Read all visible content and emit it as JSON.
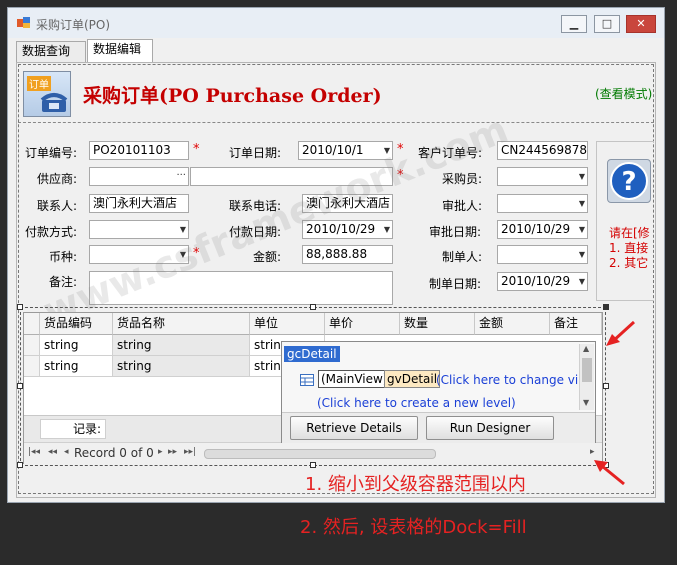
{
  "window": {
    "title": "采购订单(PO)",
    "minimize": "▁",
    "maximize": "□",
    "close": "✕"
  },
  "tabs": [
    {
      "label": "数据查询"
    },
    {
      "label": "数据编辑"
    }
  ],
  "header": {
    "title": "采购订单(PO Purchase Order)",
    "mode": "(查看模式)",
    "logo_text": "订单"
  },
  "form": {
    "order_no_label": "订单编号:",
    "order_no": "PO20101103",
    "order_date_label": "订单日期:",
    "order_date": "2010/10/1",
    "cust_order_label": "客户订单号:",
    "cust_order": "CN244569878",
    "supplier_label": "供应商:",
    "supplier_btn": "···",
    "buyer_label": "采购员:",
    "contact_label": "联系人:",
    "contact": "澳门永利大酒店",
    "phone_label": "联系电话:",
    "phone": "澳门永利大酒店",
    "approver_label": "审批人:",
    "pay_method_label": "付款方式:",
    "pay_date_label": "付款日期:",
    "pay_date": "2010/10/29",
    "approve_date_label": "审批日期:",
    "approve_date": "2010/10/29",
    "currency_label": "币种:",
    "amount_label": "金额:",
    "amount": "88,888.88",
    "creator_label": "制单人:",
    "remark_label": "备注:",
    "create_date_label": "制单日期:",
    "create_date": "2010/10/29",
    "required_mark": "*"
  },
  "side_panel": {
    "help_line1": "请在[修",
    "help_line2": "1. 直接",
    "help_line3": "2. 其它"
  },
  "grid": {
    "columns": [
      "货品编码",
      "货品名称",
      "单位",
      "单价",
      "数量",
      "金额",
      "备注"
    ],
    "rows": [
      [
        "string",
        "string",
        "string"
      ],
      [
        "string",
        "string",
        "string"
      ]
    ],
    "record_label": "记录:",
    "nav_text": "Record 0 of 0",
    "nav_first": "|◂◂",
    "nav_prev_page": "◂◂",
    "nav_prev": "◂",
    "nav_next": "▸",
    "nav_next_page": "▸▸",
    "nav_last": "▸▸|"
  },
  "popup": {
    "root": "gcDetail",
    "main_view": "(MainView)",
    "detail": "gvDetail",
    "change_link": "(Click here to change view",
    "create_link": "(Click here to create a new level)",
    "retrieve_btn": "Retrieve Details",
    "designer_btn": "Run Designer"
  },
  "annotations": {
    "note1": "1. 缩小到父级容器范围以内",
    "note2": "2. 然后, 设表格的Dock=Fill"
  },
  "watermark": "www.csframework.com"
}
